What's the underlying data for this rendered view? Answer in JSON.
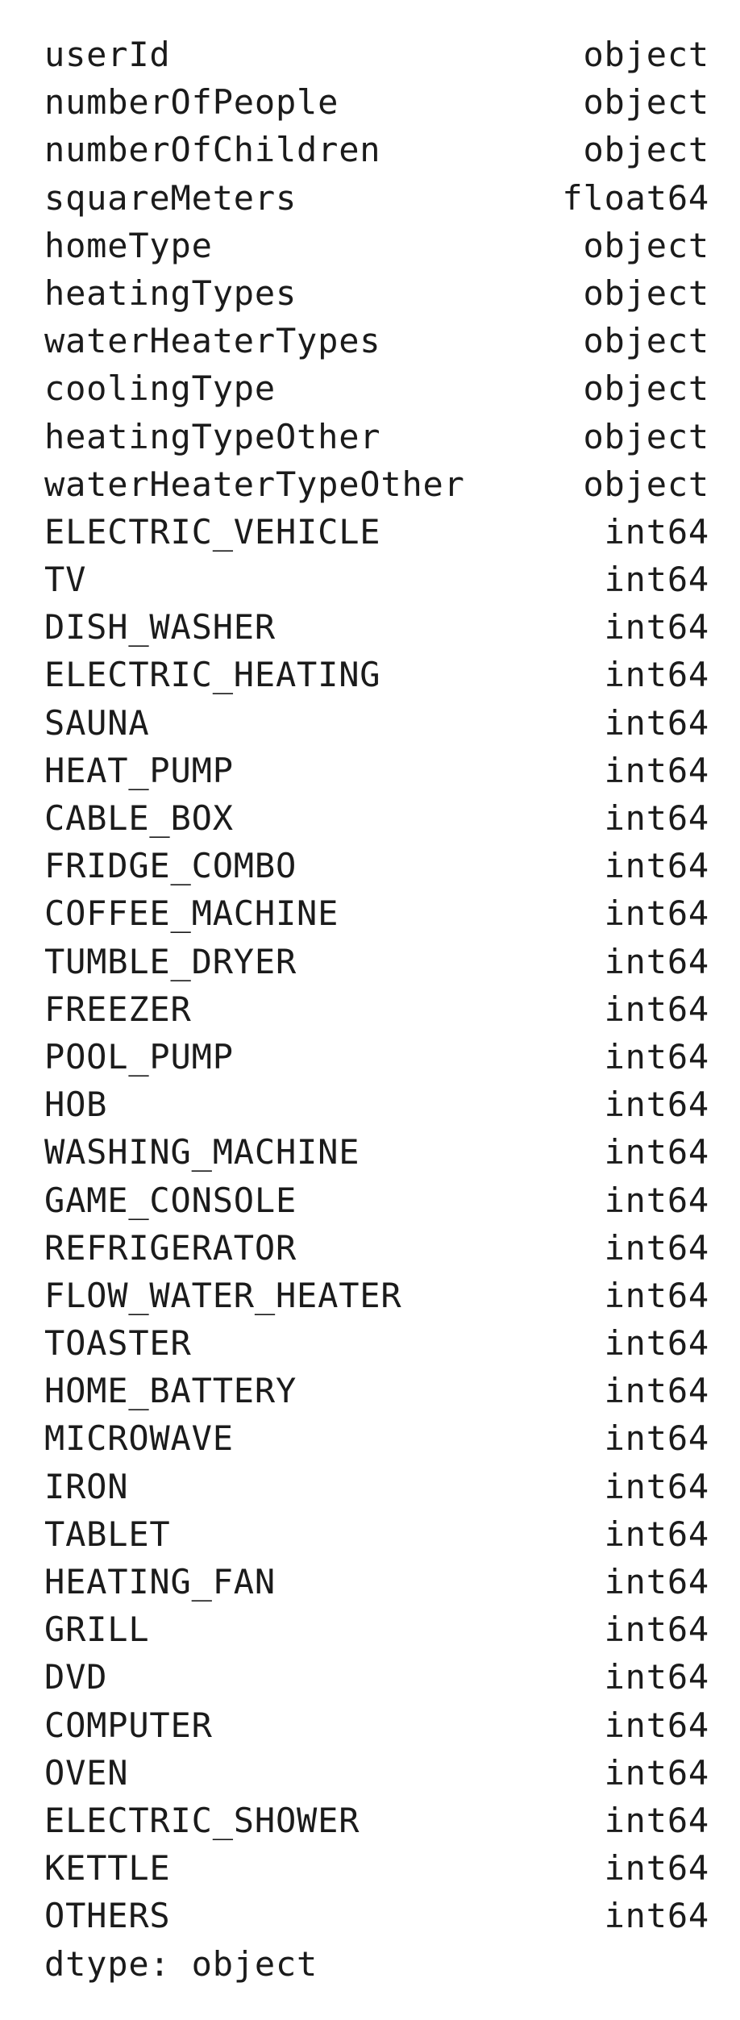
{
  "series_output": {
    "rows": [
      {
        "column": "userId",
        "dtype": "object"
      },
      {
        "column": "numberOfPeople",
        "dtype": "object"
      },
      {
        "column": "numberOfChildren",
        "dtype": "object"
      },
      {
        "column": "squareMeters",
        "dtype": "float64"
      },
      {
        "column": "homeType",
        "dtype": "object"
      },
      {
        "column": "heatingTypes",
        "dtype": "object"
      },
      {
        "column": "waterHeaterTypes",
        "dtype": "object"
      },
      {
        "column": "coolingType",
        "dtype": "object"
      },
      {
        "column": "heatingTypeOther",
        "dtype": "object"
      },
      {
        "column": "waterHeaterTypeOther",
        "dtype": "object"
      },
      {
        "column": "ELECTRIC_VEHICLE",
        "dtype": "int64"
      },
      {
        "column": "TV",
        "dtype": "int64"
      },
      {
        "column": "DISH_WASHER",
        "dtype": "int64"
      },
      {
        "column": "ELECTRIC_HEATING",
        "dtype": "int64"
      },
      {
        "column": "SAUNA",
        "dtype": "int64"
      },
      {
        "column": "HEAT_PUMP",
        "dtype": "int64"
      },
      {
        "column": "CABLE_BOX",
        "dtype": "int64"
      },
      {
        "column": "FRIDGE_COMBO",
        "dtype": "int64"
      },
      {
        "column": "COFFEE_MACHINE",
        "dtype": "int64"
      },
      {
        "column": "TUMBLE_DRYER",
        "dtype": "int64"
      },
      {
        "column": "FREEZER",
        "dtype": "int64"
      },
      {
        "column": "POOL_PUMP",
        "dtype": "int64"
      },
      {
        "column": "HOB",
        "dtype": "int64"
      },
      {
        "column": "WASHING_MACHINE",
        "dtype": "int64"
      },
      {
        "column": "GAME_CONSOLE",
        "dtype": "int64"
      },
      {
        "column": "REFRIGERATOR",
        "dtype": "int64"
      },
      {
        "column": "FLOW_WATER_HEATER",
        "dtype": "int64"
      },
      {
        "column": "TOASTER",
        "dtype": "int64"
      },
      {
        "column": "HOME_BATTERY",
        "dtype": "int64"
      },
      {
        "column": "MICROWAVE",
        "dtype": "int64"
      },
      {
        "column": "IRON",
        "dtype": "int64"
      },
      {
        "column": "TABLET",
        "dtype": "int64"
      },
      {
        "column": "HEATING_FAN",
        "dtype": "int64"
      },
      {
        "column": "GRILL",
        "dtype": "int64"
      },
      {
        "column": "DVD",
        "dtype": "int64"
      },
      {
        "column": "COMPUTER",
        "dtype": "int64"
      },
      {
        "column": "OVEN",
        "dtype": "int64"
      },
      {
        "column": "ELECTRIC_SHOWER",
        "dtype": "int64"
      },
      {
        "column": "KETTLE",
        "dtype": "int64"
      },
      {
        "column": "OTHERS",
        "dtype": "int64"
      }
    ],
    "footer": "dtype: object"
  }
}
